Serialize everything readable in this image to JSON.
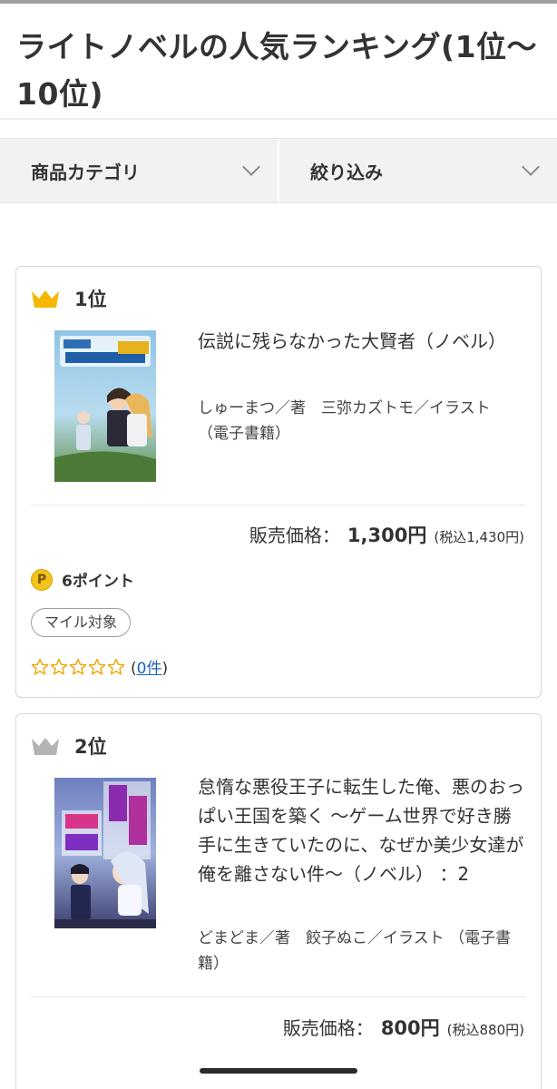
{
  "header": {
    "title": "ライトノベルの人気ランキング(1位〜10位)"
  },
  "filters": {
    "category_label": "商品カテゴリ",
    "refine_label": "絞り込み"
  },
  "colors": {
    "gold_crown": "#f5b800",
    "silver_crown": "#b3b3b3",
    "star": "#f0a500",
    "link": "#1a62b8"
  },
  "items": [
    {
      "rank": "1位",
      "title": "伝説に残らなかった大賢者（ノベル）",
      "author": "しゅーまつ／著　三弥カズトモ／イラスト （電子書籍）",
      "price_label": "販売価格：",
      "price": "1,300円",
      "price_tax": "(税込1,430円)",
      "points": "6ポイント",
      "point_icon": "P",
      "mile_badge": "マイル対象",
      "rating_stars": 0,
      "review_open": "(",
      "review_count": "0件",
      "review_close": ")"
    },
    {
      "rank": "2位",
      "title": "怠惰な悪役王子に転生した俺、悪のおっぱい王国を築く 〜ゲーム世界で好き勝手に生きていたのに、なぜか美少女達が俺を離さない件〜（ノベル） ：2",
      "author": "どまどま／著　餃子ぬこ／イラスト （電子書籍）",
      "price_label": "販売価格：",
      "price": "800円",
      "price_tax": "(税込880円)"
    }
  ]
}
